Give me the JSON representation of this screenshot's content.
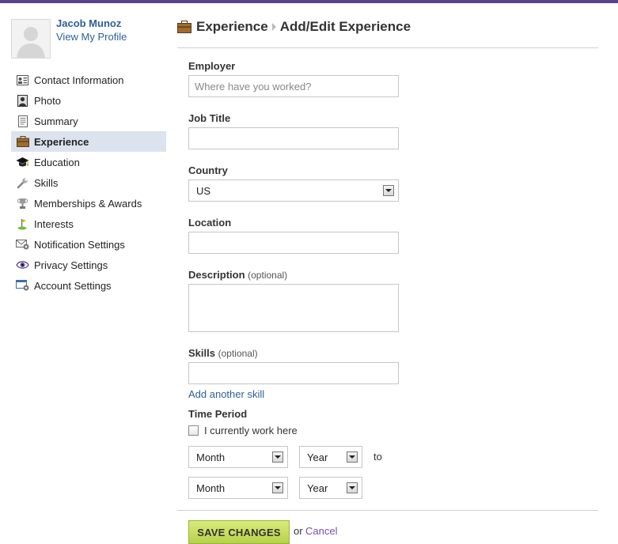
{
  "profile": {
    "name": "Jacob Munoz",
    "view_profile": "View My Profile"
  },
  "sidebar": {
    "items": [
      {
        "label": "Contact Information",
        "icon": "contact-card-icon"
      },
      {
        "label": "Photo",
        "icon": "photo-portrait-icon"
      },
      {
        "label": "Summary",
        "icon": "document-icon"
      },
      {
        "label": "Experience",
        "icon": "briefcase-icon",
        "active": true
      },
      {
        "label": "Education",
        "icon": "graduation-cap-icon"
      },
      {
        "label": "Skills",
        "icon": "wrench-icon"
      },
      {
        "label": "Memberships & Awards",
        "icon": "trophy-icon"
      },
      {
        "label": "Interests",
        "icon": "golf-flag-icon"
      },
      {
        "label": "Notification Settings",
        "icon": "envelope-gear-icon"
      },
      {
        "label": "Privacy Settings",
        "icon": "eye-icon"
      },
      {
        "label": "Account Settings",
        "icon": "window-gear-icon"
      }
    ]
  },
  "header": {
    "section": "Experience",
    "subsection": "Add/Edit Experience"
  },
  "form": {
    "employer_label": "Employer",
    "employer_placeholder": "Where have you worked?",
    "job_title_label": "Job Title",
    "country_label": "Country",
    "country_value": "US",
    "location_label": "Location",
    "description_label": "Description",
    "description_optional": "(optional)",
    "skills_label": "Skills",
    "skills_optional": "(optional)",
    "add_skill": "Add another skill",
    "time_period_label": "Time Period",
    "current_work_label": "I currently work here",
    "start_month": "Month",
    "start_year": "Year",
    "to_label": "to",
    "end_month": "Month",
    "end_year": "Year",
    "save_label": "SAVE CHANGES",
    "or_label": "or",
    "cancel_label": "Cancel"
  },
  "colors": {
    "accent": "#5b3f8a",
    "link": "#2f5f9a",
    "cancel_link": "#7a4fb0",
    "save_button": "#c5de5e",
    "active_nav": "#dde3ee"
  }
}
